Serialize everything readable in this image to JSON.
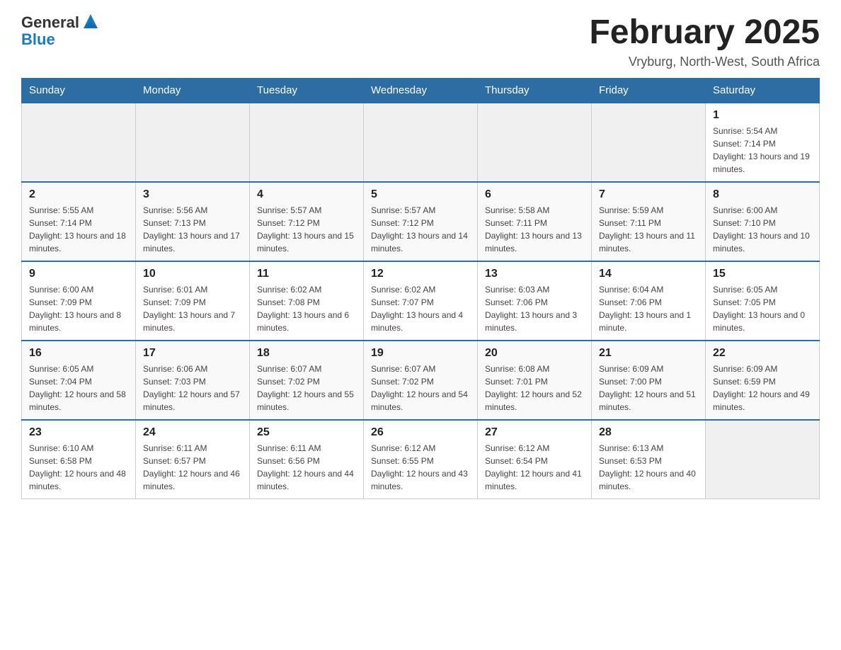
{
  "header": {
    "title": "February 2025",
    "subtitle": "Vryburg, North-West, South Africa",
    "logo_general": "General",
    "logo_blue": "Blue"
  },
  "days_of_week": [
    "Sunday",
    "Monday",
    "Tuesday",
    "Wednesday",
    "Thursday",
    "Friday",
    "Saturday"
  ],
  "weeks": [
    [
      {
        "day": "",
        "sunrise": "",
        "sunset": "",
        "daylight": ""
      },
      {
        "day": "",
        "sunrise": "",
        "sunset": "",
        "daylight": ""
      },
      {
        "day": "",
        "sunrise": "",
        "sunset": "",
        "daylight": ""
      },
      {
        "day": "",
        "sunrise": "",
        "sunset": "",
        "daylight": ""
      },
      {
        "day": "",
        "sunrise": "",
        "sunset": "",
        "daylight": ""
      },
      {
        "day": "",
        "sunrise": "",
        "sunset": "",
        "daylight": ""
      },
      {
        "day": "1",
        "sunrise": "Sunrise: 5:54 AM",
        "sunset": "Sunset: 7:14 PM",
        "daylight": "Daylight: 13 hours and 19 minutes."
      }
    ],
    [
      {
        "day": "2",
        "sunrise": "Sunrise: 5:55 AM",
        "sunset": "Sunset: 7:14 PM",
        "daylight": "Daylight: 13 hours and 18 minutes."
      },
      {
        "day": "3",
        "sunrise": "Sunrise: 5:56 AM",
        "sunset": "Sunset: 7:13 PM",
        "daylight": "Daylight: 13 hours and 17 minutes."
      },
      {
        "day": "4",
        "sunrise": "Sunrise: 5:57 AM",
        "sunset": "Sunset: 7:12 PM",
        "daylight": "Daylight: 13 hours and 15 minutes."
      },
      {
        "day": "5",
        "sunrise": "Sunrise: 5:57 AM",
        "sunset": "Sunset: 7:12 PM",
        "daylight": "Daylight: 13 hours and 14 minutes."
      },
      {
        "day": "6",
        "sunrise": "Sunrise: 5:58 AM",
        "sunset": "Sunset: 7:11 PM",
        "daylight": "Daylight: 13 hours and 13 minutes."
      },
      {
        "day": "7",
        "sunrise": "Sunrise: 5:59 AM",
        "sunset": "Sunset: 7:11 PM",
        "daylight": "Daylight: 13 hours and 11 minutes."
      },
      {
        "day": "8",
        "sunrise": "Sunrise: 6:00 AM",
        "sunset": "Sunset: 7:10 PM",
        "daylight": "Daylight: 13 hours and 10 minutes."
      }
    ],
    [
      {
        "day": "9",
        "sunrise": "Sunrise: 6:00 AM",
        "sunset": "Sunset: 7:09 PM",
        "daylight": "Daylight: 13 hours and 8 minutes."
      },
      {
        "day": "10",
        "sunrise": "Sunrise: 6:01 AM",
        "sunset": "Sunset: 7:09 PM",
        "daylight": "Daylight: 13 hours and 7 minutes."
      },
      {
        "day": "11",
        "sunrise": "Sunrise: 6:02 AM",
        "sunset": "Sunset: 7:08 PM",
        "daylight": "Daylight: 13 hours and 6 minutes."
      },
      {
        "day": "12",
        "sunrise": "Sunrise: 6:02 AM",
        "sunset": "Sunset: 7:07 PM",
        "daylight": "Daylight: 13 hours and 4 minutes."
      },
      {
        "day": "13",
        "sunrise": "Sunrise: 6:03 AM",
        "sunset": "Sunset: 7:06 PM",
        "daylight": "Daylight: 13 hours and 3 minutes."
      },
      {
        "day": "14",
        "sunrise": "Sunrise: 6:04 AM",
        "sunset": "Sunset: 7:06 PM",
        "daylight": "Daylight: 13 hours and 1 minute."
      },
      {
        "day": "15",
        "sunrise": "Sunrise: 6:05 AM",
        "sunset": "Sunset: 7:05 PM",
        "daylight": "Daylight: 13 hours and 0 minutes."
      }
    ],
    [
      {
        "day": "16",
        "sunrise": "Sunrise: 6:05 AM",
        "sunset": "Sunset: 7:04 PM",
        "daylight": "Daylight: 12 hours and 58 minutes."
      },
      {
        "day": "17",
        "sunrise": "Sunrise: 6:06 AM",
        "sunset": "Sunset: 7:03 PM",
        "daylight": "Daylight: 12 hours and 57 minutes."
      },
      {
        "day": "18",
        "sunrise": "Sunrise: 6:07 AM",
        "sunset": "Sunset: 7:02 PM",
        "daylight": "Daylight: 12 hours and 55 minutes."
      },
      {
        "day": "19",
        "sunrise": "Sunrise: 6:07 AM",
        "sunset": "Sunset: 7:02 PM",
        "daylight": "Daylight: 12 hours and 54 minutes."
      },
      {
        "day": "20",
        "sunrise": "Sunrise: 6:08 AM",
        "sunset": "Sunset: 7:01 PM",
        "daylight": "Daylight: 12 hours and 52 minutes."
      },
      {
        "day": "21",
        "sunrise": "Sunrise: 6:09 AM",
        "sunset": "Sunset: 7:00 PM",
        "daylight": "Daylight: 12 hours and 51 minutes."
      },
      {
        "day": "22",
        "sunrise": "Sunrise: 6:09 AM",
        "sunset": "Sunset: 6:59 PM",
        "daylight": "Daylight: 12 hours and 49 minutes."
      }
    ],
    [
      {
        "day": "23",
        "sunrise": "Sunrise: 6:10 AM",
        "sunset": "Sunset: 6:58 PM",
        "daylight": "Daylight: 12 hours and 48 minutes."
      },
      {
        "day": "24",
        "sunrise": "Sunrise: 6:11 AM",
        "sunset": "Sunset: 6:57 PM",
        "daylight": "Daylight: 12 hours and 46 minutes."
      },
      {
        "day": "25",
        "sunrise": "Sunrise: 6:11 AM",
        "sunset": "Sunset: 6:56 PM",
        "daylight": "Daylight: 12 hours and 44 minutes."
      },
      {
        "day": "26",
        "sunrise": "Sunrise: 6:12 AM",
        "sunset": "Sunset: 6:55 PM",
        "daylight": "Daylight: 12 hours and 43 minutes."
      },
      {
        "day": "27",
        "sunrise": "Sunrise: 6:12 AM",
        "sunset": "Sunset: 6:54 PM",
        "daylight": "Daylight: 12 hours and 41 minutes."
      },
      {
        "day": "28",
        "sunrise": "Sunrise: 6:13 AM",
        "sunset": "Sunset: 6:53 PM",
        "daylight": "Daylight: 12 hours and 40 minutes."
      },
      {
        "day": "",
        "sunrise": "",
        "sunset": "",
        "daylight": ""
      }
    ]
  ]
}
